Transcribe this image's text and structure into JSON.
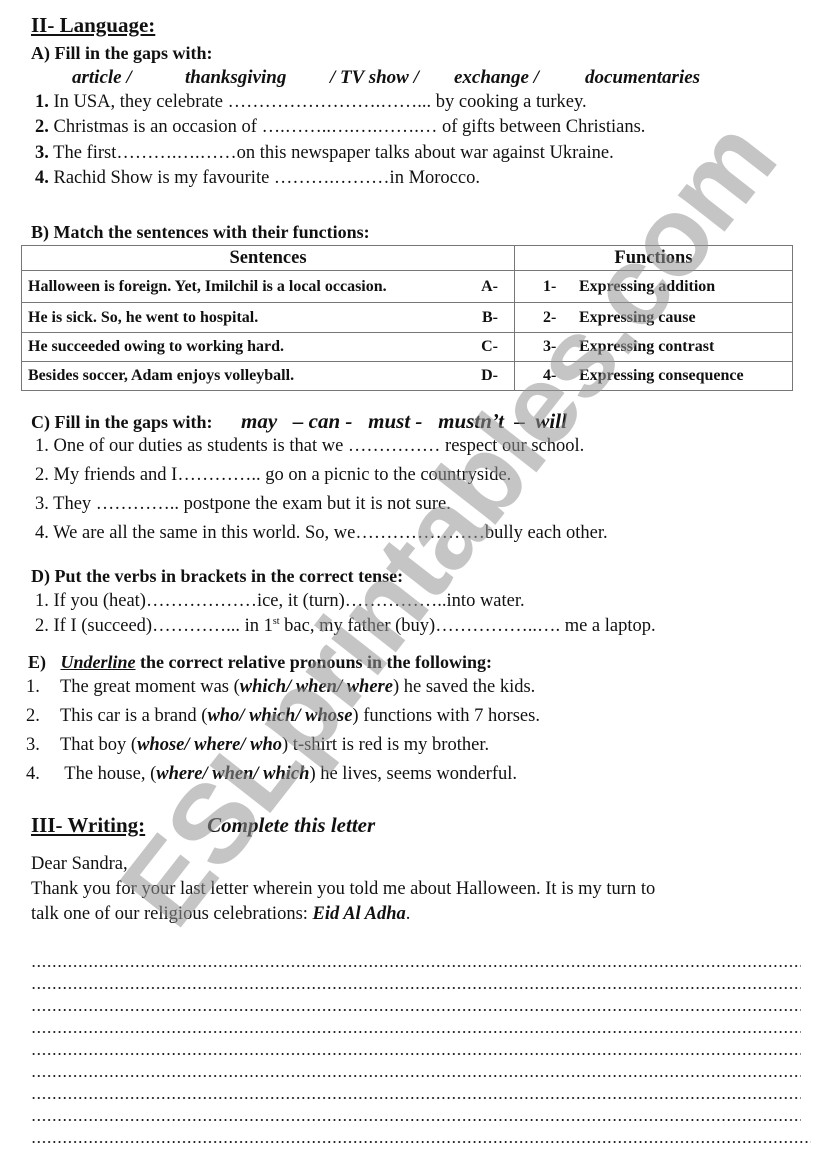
{
  "section2": {
    "title": "II- Language:",
    "partA": {
      "heading": "A) Fill in the gaps with:",
      "word_bank": [
        "article /",
        "thanksgiving",
        "/ TV show /",
        "exchange /",
        "documentaries"
      ],
      "items": [
        {
          "num": "1.",
          "text": "In USA, they celebrate …………………….……... by cooking a turkey."
        },
        {
          "num": "2.",
          "text": "Christmas is an occasion of ….……..….….…….… of gifts between Christians."
        },
        {
          "num": "3.",
          "text": "The first……….….……on this newspaper talks about war against Ukraine."
        },
        {
          "num": "4.",
          "text": "Rachid Show is my favourite ……….………in Morocco."
        }
      ]
    },
    "partB": {
      "heading": "B) Match the sentences with their functions:",
      "col_sentences": "Sentences",
      "col_functions": "Functions",
      "rows": [
        {
          "sentence": "Halloween is foreign. Yet, Imilchil is a local occasion.",
          "letter": "A-",
          "fnum": "1-",
          "function": "Expressing addition"
        },
        {
          "sentence": " He is sick. So, he went to hospital.",
          "letter": "B-",
          "fnum": "2-",
          "function": "Expressing cause"
        },
        {
          "sentence": "He succeeded owing to working hard.",
          "letter": "C-",
          "fnum": "3-",
          "function": "Expressing contrast"
        },
        {
          "sentence": "Besides soccer, Adam enjoys volleyball.",
          "letter": "D-",
          "fnum": "4-",
          "function": "Expressing consequence"
        }
      ]
    },
    "partC": {
      "heading": "C) Fill in the gaps with:",
      "word_bank": "may   – can -   must -   mustn’t  –  will",
      "items": [
        {
          "num": "1.",
          "text": "One of our duties as students is that we ……………  respect our school."
        },
        {
          "num": "2.",
          "text": "My friends and I………….. go on a picnic to the countryside."
        },
        {
          "num": "3.",
          "text": "They ………….. postpone the exam but it is not sure."
        },
        {
          "num": "4.",
          "text": "We are all the same in this world. So, we…………………bully each other."
        }
      ]
    },
    "partD": {
      "heading": "D) Put the verbs in brackets in the correct tense:",
      "items": [
        {
          "num": "1.",
          "text": "If you (heat)………………ice, it (turn)……………..into water."
        },
        {
          "num": "2.",
          "pre": "If I (succeed)…………... in 1",
          "sup": "st",
          "post": " bac, my father (buy)……………..…. me a laptop."
        }
      ]
    },
    "partE": {
      "label": "E)",
      "heading_em": "Underline",
      "heading_rest": " the correct relative pronouns in the following:",
      "items": [
        {
          "num": "1.",
          "pre": "The great moment was (",
          "choices": "which/ when/ where",
          "post": ") he saved the kids."
        },
        {
          "num": "2.",
          "pre": "This car is a brand (",
          "choices": "who/ which/ whose",
          "post": ") functions with 7 horses."
        },
        {
          "num": "3.",
          "pre": "That boy (",
          "choices": "whose/ where/ who",
          "post": ") t-shirt is red is my brother."
        },
        {
          "num": "4.",
          "pre": " The house, (",
          "choices": "where/ when/ which",
          "post": ") he lives, seems wonderful."
        }
      ]
    }
  },
  "section3": {
    "title": "III- Writing:",
    "instruction": "Complete this letter",
    "greeting": "Dear Sandra,",
    "body_line1": "Thank you for your last letter wherein you told me about Halloween. It is my turn to",
    "body_line2_pre": "talk one of our religious celebrations: ",
    "body_line2_em": "Eid Al Adha",
    "body_line2_post": ".",
    "writing_lines": 9
  },
  "watermark": "ESLprintables.com"
}
